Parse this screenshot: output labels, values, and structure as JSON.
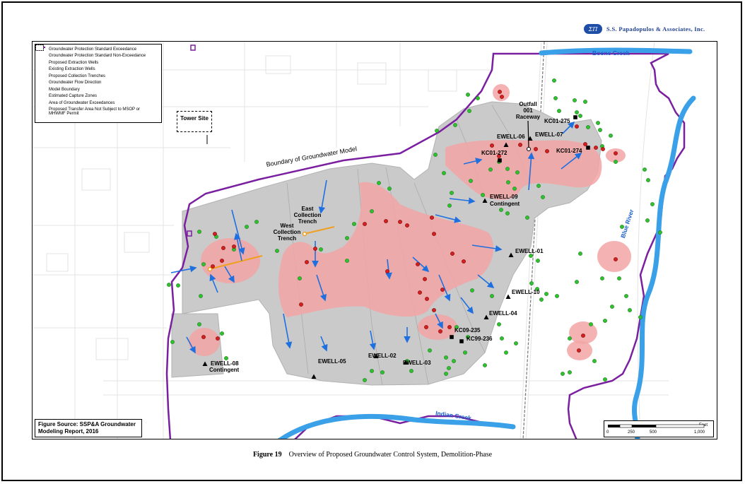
{
  "header": {
    "logo_mark": "ΣΠ",
    "company": "S.S. Papadopulos & Associates, Inc.",
    "brand_color": "#1f4ea8"
  },
  "legend": {
    "items": [
      {
        "label": "Groundwater Protection Standard Exceedance",
        "symbol": "red-dot-icon"
      },
      {
        "label": "Groundwater Protection Standard Non-Exceedance",
        "symbol": "green-dot-icon"
      },
      {
        "label": "Proposed Extraction Wells",
        "symbol": "black-triangle-icon"
      },
      {
        "label": "Existing Extraction Wells",
        "symbol": "black-square-icon"
      },
      {
        "label": "Proposed Collection Trenches",
        "symbol": "orange-line-icon"
      },
      {
        "label": "Groundwater Flow Direction",
        "symbol": "blue-arrow-icon"
      },
      {
        "label": "Model Boundary",
        "symbol": "purple-line-icon"
      },
      {
        "label": "Estimated Capture Zones",
        "symbol": "gray-fill-icon"
      },
      {
        "label": "Area of Groundwater Exceedances",
        "symbol": "pink-fill-icon"
      },
      {
        "label": "Proposed Transfer Area Not Subject to MSOP or MHWMF Permit",
        "symbol": "dashed-box-icon"
      }
    ]
  },
  "map_labels": {
    "tower_site": "Tower Site",
    "model_boundary": "Boundary of Groundwater Model",
    "west_trench": "West Collection Trench",
    "east_trench": "East Collection Trench",
    "outfall": "Outfall 001 Raceway",
    "wells": {
      "ewell_06": "EWELL-06",
      "ewell_07": "EWELL-07",
      "kc01_272": "KC01-272",
      "kc01_275": "KC01-275",
      "kc01_274": "KC01-274",
      "ewell_09": "EWELL-09",
      "ewell_09_note": "Contingent",
      "ewell_01": "EWELL-01",
      "ewell_10": "EWELL-10",
      "ewell_04": "EWELL-04",
      "kc09_235": "KC09-235",
      "kc99_236": "KC99-236",
      "ewell_02": "EWELL-02",
      "ewell_03": "EWELL-03",
      "ewell_05": "EWELL-05",
      "ewell_08": "EWELL-08",
      "ewell_08_note": "Contingent"
    }
  },
  "rivers": {
    "boone_creek": "Boone Creek",
    "blue_river": "Blue River",
    "indian_creek": "Indian Creek"
  },
  "source_note": "Figure Source: SSP&A Groundwater Modeling Report, 2016",
  "scale_bar": {
    "unit": "Feet",
    "ticks": [
      "0",
      "250",
      "500",
      "1,000"
    ]
  },
  "caption": {
    "number": "Figure 19",
    "text": "Overview of Proposed Groundwater Control System, Demolition-Phase"
  },
  "colors": {
    "exceedance": "#d42020",
    "non_exceedance": "#2fc22f",
    "capture_zone": "#c9c9c9",
    "exceedance_area": "#f2a5a5",
    "model_boundary": "#7a1fa0",
    "trench": "#f0a020",
    "flow_arrow": "#1e6fe0",
    "river": "#3aa0e8"
  }
}
